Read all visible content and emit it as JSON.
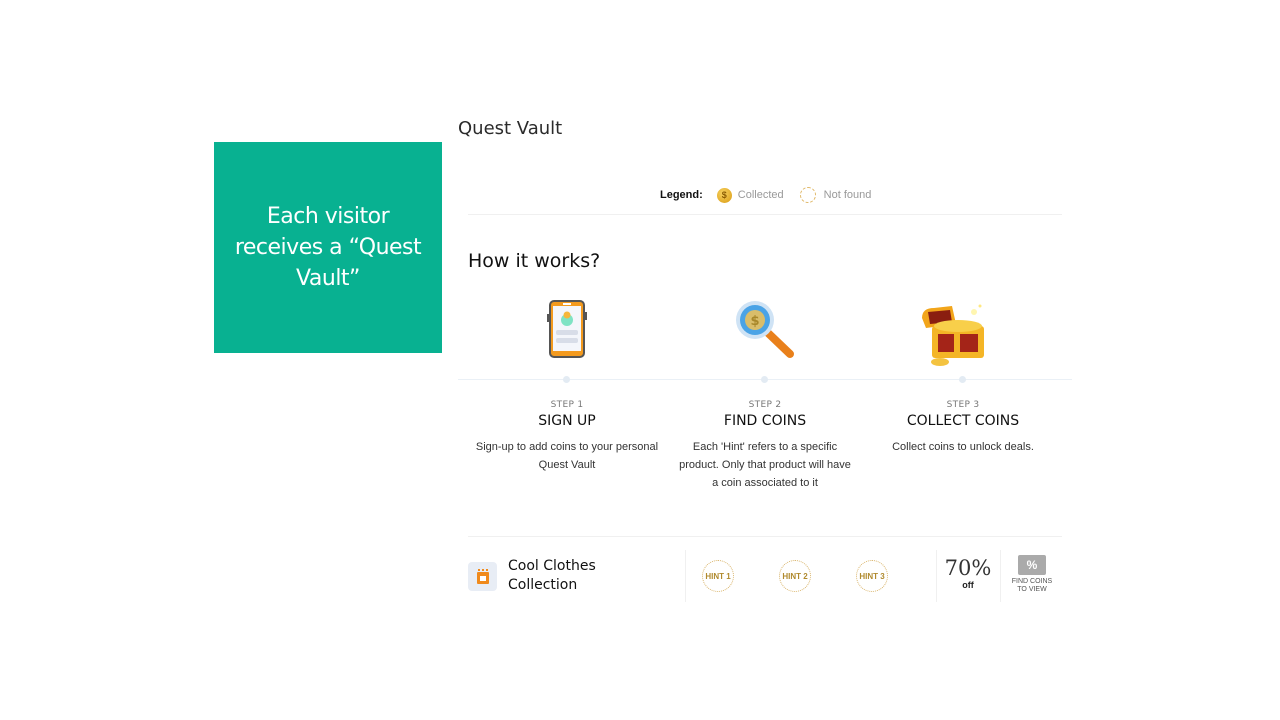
{
  "callout": {
    "text": "Each visitor receives a “Quest Vault”",
    "color": "#08b191"
  },
  "vault": {
    "title": "Quest Vault",
    "legend": {
      "label": "Legend:",
      "collected": "Collected",
      "not_found": "Not found",
      "coin_symbol": "$"
    }
  },
  "how": {
    "title": "How it works?",
    "steps": [
      {
        "num": "STEP 1",
        "title": "SIGN UP",
        "desc": "Sign-up to add coins to your personal Quest Vault",
        "icon": "phone-signup-icon"
      },
      {
        "num": "STEP 2",
        "title": "FIND COINS",
        "desc": "Each 'Hint' refers to a specific product. Only that product will have a coin associated to it",
        "icon": "magnifier-coin-icon"
      },
      {
        "num": "STEP 3",
        "title": "COLLECT COINS",
        "desc": "Collect coins to unlock deals.",
        "icon": "treasure-chest-icon"
      }
    ]
  },
  "product": {
    "name": "Cool Clothes Collection",
    "hints": [
      "HINT 1",
      "HINT 2",
      "HINT 3"
    ],
    "discount_value": "70%",
    "discount_suffix": "off",
    "coupon_symbol": "%",
    "coupon_label": "FIND COINS TO VIEW"
  }
}
